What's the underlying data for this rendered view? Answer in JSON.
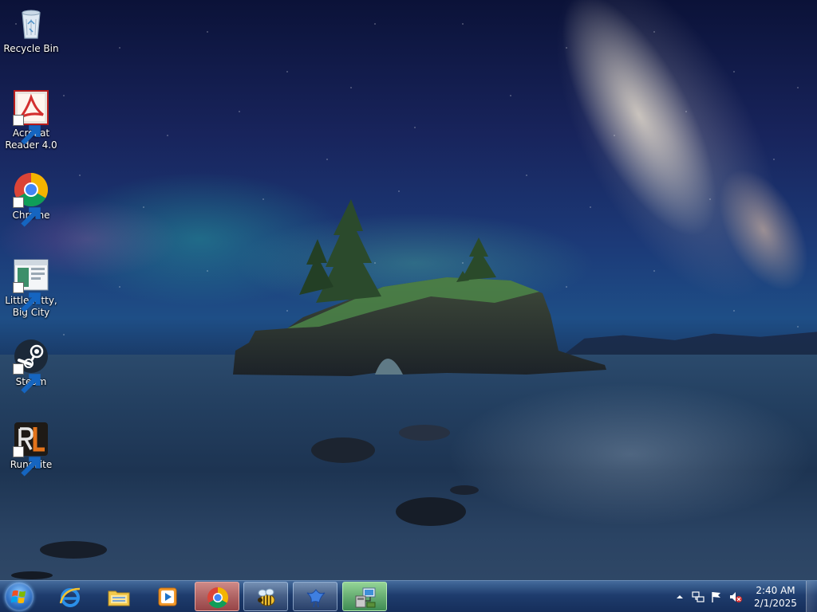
{
  "desktop": {
    "icons": [
      {
        "label": "Recycle Bin",
        "icon": "recycle-bin-icon"
      },
      {
        "label": "Acrobat Reader 4.0",
        "icon": "acrobat-reader-icon"
      },
      {
        "label": "Chrome",
        "icon": "chrome-icon"
      },
      {
        "label": "Little Kitty, Big City",
        "icon": "little-kitty-big-city-icon"
      },
      {
        "label": "Steam",
        "icon": "steam-icon"
      },
      {
        "label": "RuneLite",
        "icon": "runelite-icon"
      }
    ]
  },
  "taskbar": {
    "start_icon": "windows-start-icon",
    "buttons": [
      {
        "icon": "internet-explorer-icon",
        "state": "pinned"
      },
      {
        "icon": "file-explorer-icon",
        "state": "pinned"
      },
      {
        "icon": "media-player-icon",
        "state": "pinned"
      },
      {
        "icon": "chrome-icon",
        "state": "running-highlighted"
      },
      {
        "icon": "bee-app-icon",
        "state": "running"
      },
      {
        "icon": "bird-app-icon",
        "state": "running"
      },
      {
        "icon": "network-setup-icon",
        "state": "running-highlighted"
      }
    ],
    "tray": {
      "icons": [
        "show-hidden-icons-icon",
        "network-icon",
        "action-center-flag-icon",
        "volume-muted-icon"
      ],
      "time": "2:40 AM",
      "date": "2/1/2025"
    }
  },
  "colors": {
    "taskbar": "#1e3c6e",
    "label_text": "#ffffff"
  }
}
